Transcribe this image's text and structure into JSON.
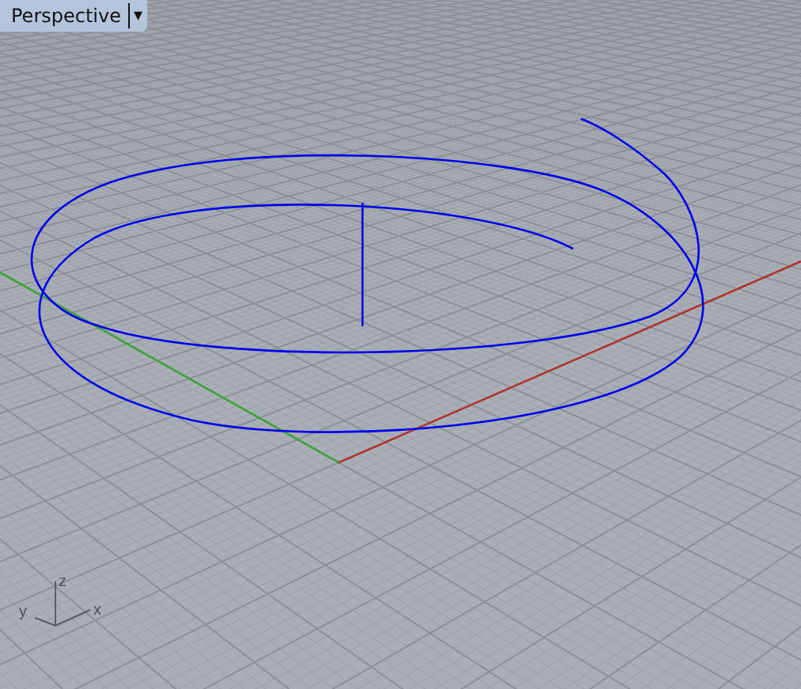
{
  "viewport": {
    "title": "Perspective",
    "menu_glyph": "▾"
  },
  "axis_labels": [
    {
      "kind": "z",
      "text": "z"
    },
    {
      "kind": "y",
      "text": "y"
    },
    {
      "kind": "x",
      "text": "x"
    }
  ]
}
